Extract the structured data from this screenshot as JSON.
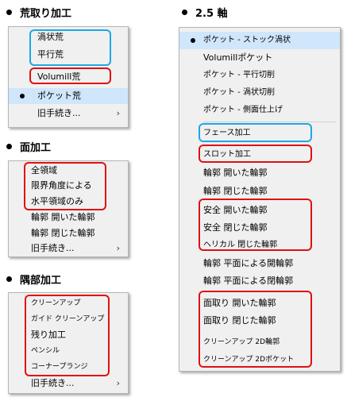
{
  "headings": {
    "rough": "荒取り加工",
    "face": "面加工",
    "corner": "隅部加工",
    "d25": "2.5 軸"
  },
  "menu_rough": {
    "items": [
      "渦状荒",
      "平行荒",
      "Volumill荒",
      "ポケット荒",
      "旧手続き..."
    ],
    "submenu_arrow": "›"
  },
  "menu_face": {
    "items": [
      "全領域",
      "限界角度による",
      "水平領域のみ",
      "輪郭 開いた輪郭",
      "輪郭 閉じた輪郭",
      "旧手続き..."
    ],
    "submenu_arrow": "›"
  },
  "menu_corner": {
    "items": [
      "クリーンアップ",
      "ガイド クリーンアップ",
      "残り加工",
      "ペンシル",
      "コーナープランジ",
      "旧手続き..."
    ],
    "submenu_arrow": "›"
  },
  "menu_25": {
    "items": [
      "ポケット - ストック渦状",
      "Volumillポケット",
      "ポケット - 平行切削",
      "ポケット - 渦状切削",
      "ポケット - 側面仕上げ",
      "フェース加工",
      "スロット加工",
      "輪郭 開いた輪郭",
      "輪郭 閉じた輪郭",
      "安全 開いた輪郭",
      "安全 閉じた輪郭",
      "ヘリカル 閉じた輪郭",
      "輪郭 平面による開輪郭",
      "輪郭 平面による閉輪郭",
      "面取り 開いた輪郭",
      "面取り 閉じた輪郭",
      "クリーンアップ 2D輪郭",
      "クリーンアップ 2Dポケット"
    ]
  },
  "colors": {
    "highlight_red": "#e01010",
    "highlight_blue": "#1ea7e6",
    "selected_bg": "#cfe6fb",
    "menu_bg": "#f0f0f0"
  }
}
